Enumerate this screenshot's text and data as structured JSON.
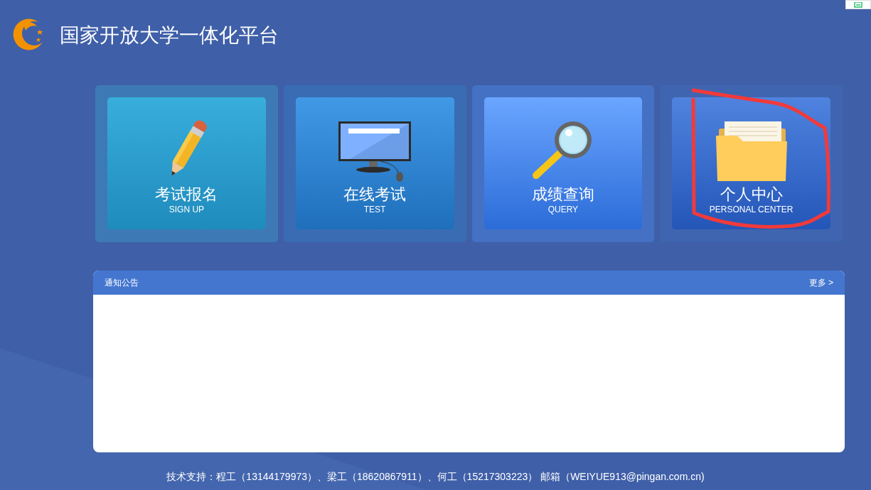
{
  "header": {
    "title": "国家开放大学一体化平台"
  },
  "tiles": [
    {
      "kind": "pencil",
      "title": "考试报名",
      "subtitle": "SIGN UP"
    },
    {
      "kind": "monitor",
      "title": "在线考试",
      "subtitle": "TEST"
    },
    {
      "kind": "magnifier",
      "title": "成绩查询",
      "subtitle": "QUERY"
    },
    {
      "kind": "folder",
      "title": "个人中心",
      "subtitle": "PERSONAL CENTER"
    }
  ],
  "notice": {
    "title": "通知公告",
    "more": "更多 >"
  },
  "footer": {
    "text": "技术支持：程工（13144179973）、梁工（18620867911）、何工（15217303223） 邮箱（WEIYUE913@pingan.com.cn)"
  }
}
